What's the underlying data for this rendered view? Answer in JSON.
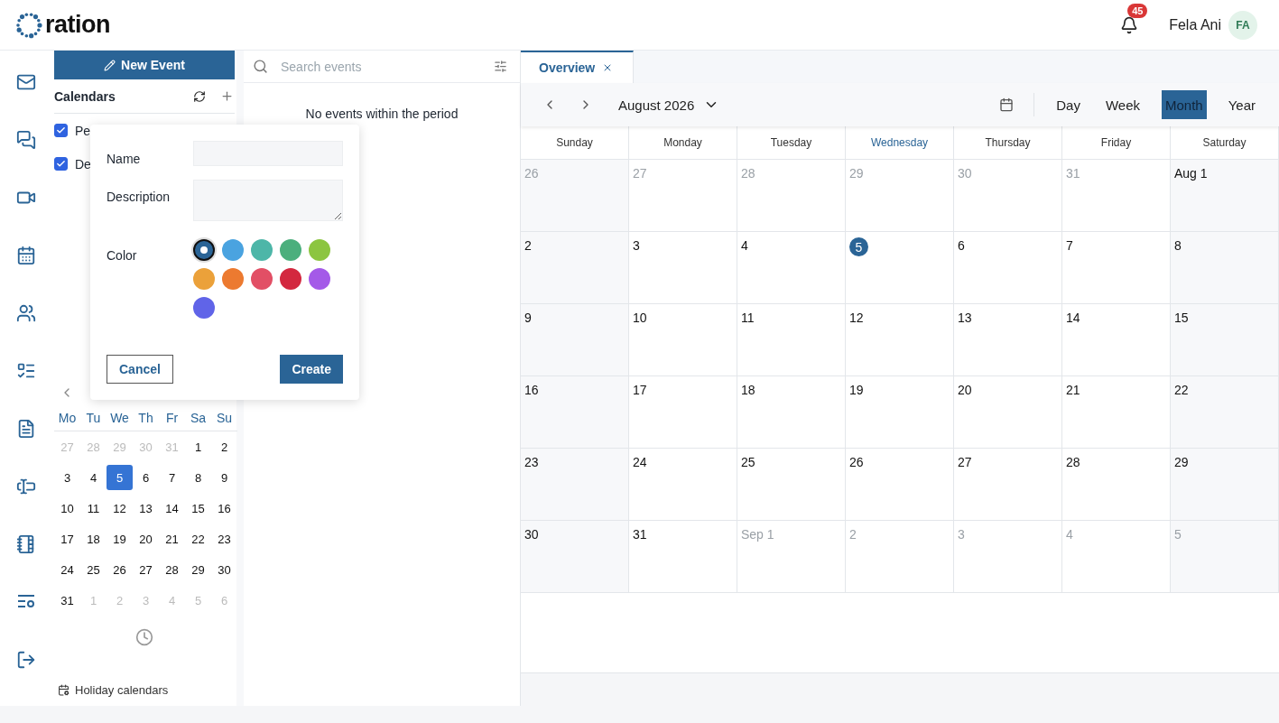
{
  "header": {
    "logo": "ration",
    "notifications": "45",
    "user_name": "Fela Ani",
    "avatar_initials": "FA"
  },
  "sidebar": {
    "new_event_button": "New Event",
    "calendars_heading": "Calendars",
    "calendars": [
      {
        "label": "Pe",
        "checked": true
      },
      {
        "label": "De",
        "checked": true
      }
    ],
    "mini_calendar": {
      "weekdays": [
        "Mo",
        "Tu",
        "We",
        "Th",
        "Fr",
        "Sa",
        "Su"
      ],
      "days": [
        {
          "label": "27",
          "muted": true,
          "selected": false
        },
        {
          "label": "28",
          "muted": true,
          "selected": false
        },
        {
          "label": "29",
          "muted": true,
          "selected": false
        },
        {
          "label": "30",
          "muted": true,
          "selected": false
        },
        {
          "label": "31",
          "muted": true,
          "selected": false
        },
        {
          "label": "1",
          "muted": false,
          "selected": false
        },
        {
          "label": "2",
          "muted": false,
          "selected": false
        },
        {
          "label": "3",
          "muted": false,
          "selected": false
        },
        {
          "label": "4",
          "muted": false,
          "selected": false
        },
        {
          "label": "5",
          "muted": false,
          "selected": true
        },
        {
          "label": "6",
          "muted": false,
          "selected": false
        },
        {
          "label": "7",
          "muted": false,
          "selected": false
        },
        {
          "label": "8",
          "muted": false,
          "selected": false
        },
        {
          "label": "9",
          "muted": false,
          "selected": false
        },
        {
          "label": "10",
          "muted": false,
          "selected": false
        },
        {
          "label": "11",
          "muted": false,
          "selected": false
        },
        {
          "label": "12",
          "muted": false,
          "selected": false
        },
        {
          "label": "13",
          "muted": false,
          "selected": false
        },
        {
          "label": "14",
          "muted": false,
          "selected": false
        },
        {
          "label": "15",
          "muted": false,
          "selected": false
        },
        {
          "label": "16",
          "muted": false,
          "selected": false
        },
        {
          "label": "17",
          "muted": false,
          "selected": false
        },
        {
          "label": "18",
          "muted": false,
          "selected": false
        },
        {
          "label": "19",
          "muted": false,
          "selected": false
        },
        {
          "label": "20",
          "muted": false,
          "selected": false
        },
        {
          "label": "21",
          "muted": false,
          "selected": false
        },
        {
          "label": "22",
          "muted": false,
          "selected": false
        },
        {
          "label": "23",
          "muted": false,
          "selected": false
        },
        {
          "label": "24",
          "muted": false,
          "selected": false
        },
        {
          "label": "25",
          "muted": false,
          "selected": false
        },
        {
          "label": "26",
          "muted": false,
          "selected": false
        },
        {
          "label": "27",
          "muted": false,
          "selected": false
        },
        {
          "label": "28",
          "muted": false,
          "selected": false
        },
        {
          "label": "29",
          "muted": false,
          "selected": false
        },
        {
          "label": "30",
          "muted": false,
          "selected": false
        },
        {
          "label": "31",
          "muted": false,
          "selected": false
        },
        {
          "label": "1",
          "muted": true,
          "selected": false
        },
        {
          "label": "2",
          "muted": true,
          "selected": false
        },
        {
          "label": "3",
          "muted": true,
          "selected": false
        },
        {
          "label": "4",
          "muted": true,
          "selected": false
        },
        {
          "label": "5",
          "muted": true,
          "selected": false
        },
        {
          "label": "6",
          "muted": true,
          "selected": false
        }
      ]
    },
    "holiday_link": "Holiday calendars"
  },
  "popover": {
    "name_label": "Name",
    "description_label": "Description",
    "color_label": "Color",
    "colors": [
      {
        "color": "#2a6496",
        "selected": true
      },
      {
        "color": "#4aa3e0",
        "selected": false
      },
      {
        "color": "#4db6a8",
        "selected": false
      },
      {
        "color": "#4caf7d",
        "selected": false
      },
      {
        "color": "#8cc540",
        "selected": false
      },
      {
        "color": "#eba13a",
        "selected": false
      },
      {
        "color": "#ec7a30",
        "selected": false
      },
      {
        "color": "#e24f65",
        "selected": false
      },
      {
        "color": "#d3283f",
        "selected": false
      },
      {
        "color": "#a45ae8",
        "selected": false
      },
      {
        "color": "#6064e8",
        "selected": false
      }
    ],
    "cancel_button": "Cancel",
    "create_button": "Create"
  },
  "events_panel": {
    "search": {
      "placeholder": "Search events"
    },
    "empty_message": "No events within the period"
  },
  "tabs": [
    {
      "label": "Overview",
      "selected": true
    }
  ],
  "toolbar": {
    "period": "August 2026",
    "views": [
      {
        "label": "Day",
        "selected": false
      },
      {
        "label": "Week",
        "selected": false
      },
      {
        "label": "Month",
        "selected": true
      },
      {
        "label": "Year",
        "selected": false
      }
    ]
  },
  "month": {
    "weekdays": [
      {
        "label": "Sunday",
        "today": false
      },
      {
        "label": "Monday",
        "today": false
      },
      {
        "label": "Tuesday",
        "today": false
      },
      {
        "label": "Wednesday",
        "today": true
      },
      {
        "label": "Thursday",
        "today": false
      },
      {
        "label": "Friday",
        "today": false
      },
      {
        "label": "Saturday",
        "today": false
      }
    ],
    "weeks": [
      [
        {
          "label": "26",
          "muted": true,
          "today": false
        },
        {
          "label": "27",
          "muted": true,
          "today": false
        },
        {
          "label": "28",
          "muted": true,
          "today": false
        },
        {
          "label": "29",
          "muted": true,
          "today": false
        },
        {
          "label": "30",
          "muted": true,
          "today": false
        },
        {
          "label": "31",
          "muted": true,
          "today": false
        },
        {
          "label": "Aug 1",
          "muted": false,
          "today": false
        }
      ],
      [
        {
          "label": "2",
          "muted": false,
          "today": false
        },
        {
          "label": "3",
          "muted": false,
          "today": false
        },
        {
          "label": "4",
          "muted": false,
          "today": false
        },
        {
          "label": "5",
          "muted": false,
          "today": true
        },
        {
          "label": "6",
          "muted": false,
          "today": false
        },
        {
          "label": "7",
          "muted": false,
          "today": false
        },
        {
          "label": "8",
          "muted": false,
          "today": false
        }
      ],
      [
        {
          "label": "9",
          "muted": false,
          "today": false
        },
        {
          "label": "10",
          "muted": false,
          "today": false
        },
        {
          "label": "11",
          "muted": false,
          "today": false
        },
        {
          "label": "12",
          "muted": false,
          "today": false
        },
        {
          "label": "13",
          "muted": false,
          "today": false
        },
        {
          "label": "14",
          "muted": false,
          "today": false
        },
        {
          "label": "15",
          "muted": false,
          "today": false
        }
      ],
      [
        {
          "label": "16",
          "muted": false,
          "today": false
        },
        {
          "label": "17",
          "muted": false,
          "today": false
        },
        {
          "label": "18",
          "muted": false,
          "today": false
        },
        {
          "label": "19",
          "muted": false,
          "today": false
        },
        {
          "label": "20",
          "muted": false,
          "today": false
        },
        {
          "label": "21",
          "muted": false,
          "today": false
        },
        {
          "label": "22",
          "muted": false,
          "today": false
        }
      ],
      [
        {
          "label": "23",
          "muted": false,
          "today": false
        },
        {
          "label": "24",
          "muted": false,
          "today": false
        },
        {
          "label": "25",
          "muted": false,
          "today": false
        },
        {
          "label": "26",
          "muted": false,
          "today": false
        },
        {
          "label": "27",
          "muted": false,
          "today": false
        },
        {
          "label": "28",
          "muted": false,
          "today": false
        },
        {
          "label": "29",
          "muted": false,
          "today": false
        }
      ],
      [
        {
          "label": "30",
          "muted": false,
          "today": false
        },
        {
          "label": "31",
          "muted": false,
          "today": false
        },
        {
          "label": "Sep 1",
          "muted": true,
          "today": false
        },
        {
          "label": "2",
          "muted": true,
          "today": false
        },
        {
          "label": "3",
          "muted": true,
          "today": false
        },
        {
          "label": "4",
          "muted": true,
          "today": false
        },
        {
          "label": "5",
          "muted": true,
          "today": false
        }
      ]
    ]
  }
}
